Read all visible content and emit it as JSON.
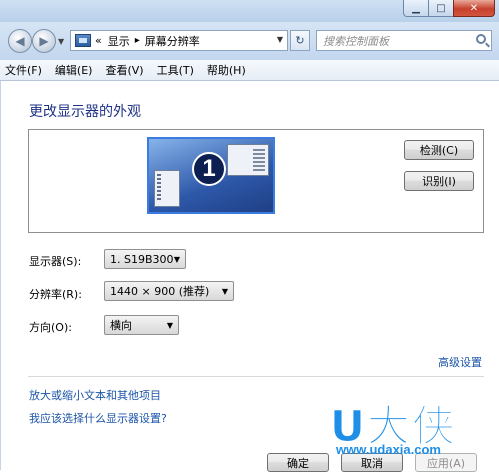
{
  "titlebar": {
    "buttons": [
      {
        "name": "minimize",
        "glyph": "▁"
      },
      {
        "name": "maximize",
        "glyph": "□"
      },
      {
        "name": "close",
        "glyph": "✕"
      }
    ]
  },
  "address": {
    "prefix": "«",
    "breadcrumb": [
      "显示",
      "屏幕分辨率"
    ],
    "separator": "▸",
    "search_placeholder": "搜索控制面板"
  },
  "menu": {
    "items": [
      "文件(F)",
      "编辑(E)",
      "查看(V)",
      "工具(T)",
      "帮助(H)"
    ]
  },
  "main": {
    "title": "更改显示器的外观",
    "monitor_number": "1",
    "detect_label": "检测(C)",
    "identify_label": "识别(I)",
    "display_label": "显示器(S):",
    "display_value": "1. S19B300",
    "resolution_label": "分辨率(R):",
    "resolution_value": "1440 × 900 (推荐)",
    "orientation_label": "方向(O):",
    "orientation_value": "横向",
    "advanced_link": "高级设置",
    "text_size_link": "放大或缩小文本和其他项目",
    "which_settings_link": "我应该选择什么显示器设置?"
  },
  "footer": {
    "ok_label": "确定",
    "cancel_label": "取消",
    "apply_label": "应用(A)"
  },
  "watermark": {
    "logo_text": "U大侠",
    "url": "www.udaxia.com"
  },
  "colors": {
    "link": "#1c55a8",
    "title": "#1e3287",
    "watermark": "#1e8ee6"
  }
}
